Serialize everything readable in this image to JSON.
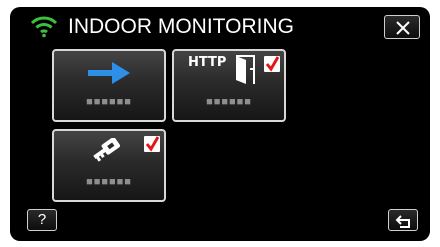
{
  "header": {
    "title": "INDOOR MONITORING",
    "status_icon": "wifi-icon",
    "close_icon": "close-icon"
  },
  "tiles": [
    {
      "icon": "arrow-right-icon",
      "label": "■■■■■■",
      "checked": false
    },
    {
      "icon": "http-door-icon",
      "icon_text": "HTTP",
      "label": "■■■■■■",
      "checked": true
    },
    {
      "icon": "key-icon",
      "label": "■■■■■■",
      "checked": true
    }
  ],
  "footer": {
    "help_label": "?",
    "back_icon": "return-icon"
  },
  "colors": {
    "wifi": "#3fbf3f",
    "arrow": "#2e8fe8",
    "check": "#e01818",
    "background": "#000000"
  }
}
